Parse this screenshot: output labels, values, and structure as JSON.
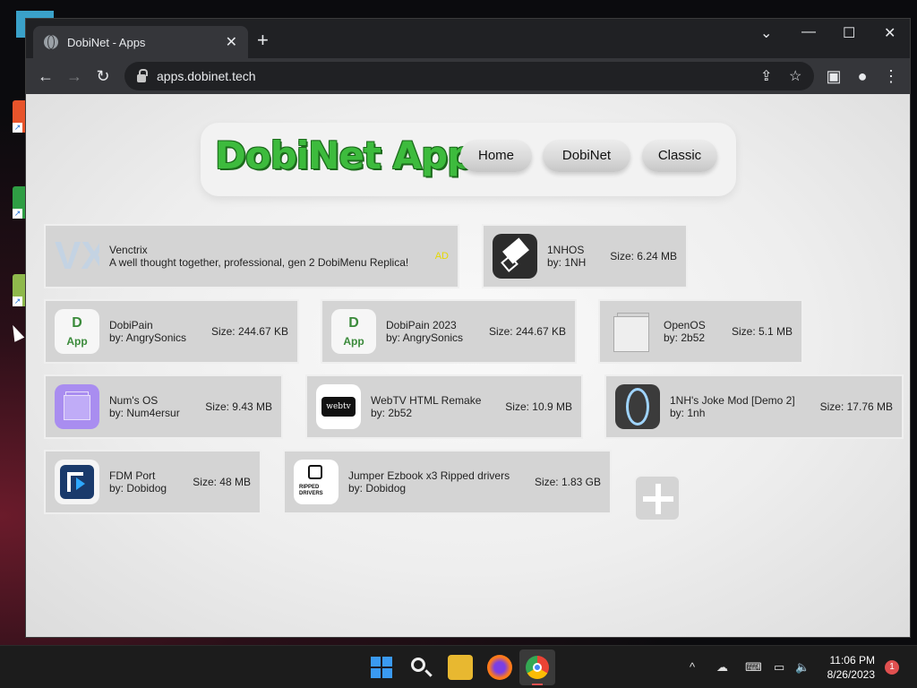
{
  "browser": {
    "tab_title": "DobiNet - Apps",
    "url": "apps.dobinet.tech"
  },
  "site": {
    "logo": "DobiNet Apps",
    "nav": [
      "Home",
      "DobiNet",
      "Classic"
    ]
  },
  "featured": {
    "name": "Venctrix",
    "description": "A well thought together, professional, gen 2 DobiMenu Replica!",
    "badge": "AD",
    "icon": "VX"
  },
  "apps": [
    {
      "name": "1NHOS",
      "author": "by: 1NH",
      "size": "Size: 6.24 MB",
      "icon": "eraser-icon"
    },
    {
      "name": "DobiPain",
      "author": "by: AngrySonics",
      "size": "Size: 244.67 KB",
      "icon": "dobipain-icon"
    },
    {
      "name": "DobiPain 2023",
      "author": "by: AngrySonics",
      "size": "Size: 244.67 KB",
      "icon": "dobipain-icon"
    },
    {
      "name": "OpenOS",
      "author": "by: 2b52",
      "size": "Size: 5.1 MB",
      "icon": "window-icon"
    },
    {
      "name": "Num's OS",
      "author": "by: Num4ersur",
      "size": "Size: 9.43 MB",
      "icon": "purple-window-icon"
    },
    {
      "name": "WebTV HTML Remake",
      "author": "by: 2b52",
      "size": "Size: 10.9 MB",
      "icon": "webtv-icon"
    },
    {
      "name": "1NH's Joke Mod [Demo 2]",
      "author": "by: 1nh",
      "size": "Size: 17.76 MB",
      "icon": "portal-icon"
    },
    {
      "name": "FDM Port",
      "author": "by: Dobidog",
      "size": "Size: 48 MB",
      "icon": "fdm-icon"
    },
    {
      "name": "Jumper Ezbook x3 Ripped drivers",
      "author": "by: Dobidog",
      "size": "Size: 1.83 GB",
      "icon": "jumper-icon"
    }
  ],
  "dobipain_icon_text": [
    "D",
    "App"
  ],
  "webtv_icon_text": "webtv",
  "jumper_icon_text": [
    "RIPPED",
    "DRIVERS"
  ],
  "taskbar": {
    "time": "11:06 PM",
    "date": "8/26/2023",
    "notifications": "1"
  },
  "colors": {
    "logo_green": "#3dbb3d",
    "card_bg": "#d4d4d4",
    "ad_yellow": "#e5d900"
  }
}
